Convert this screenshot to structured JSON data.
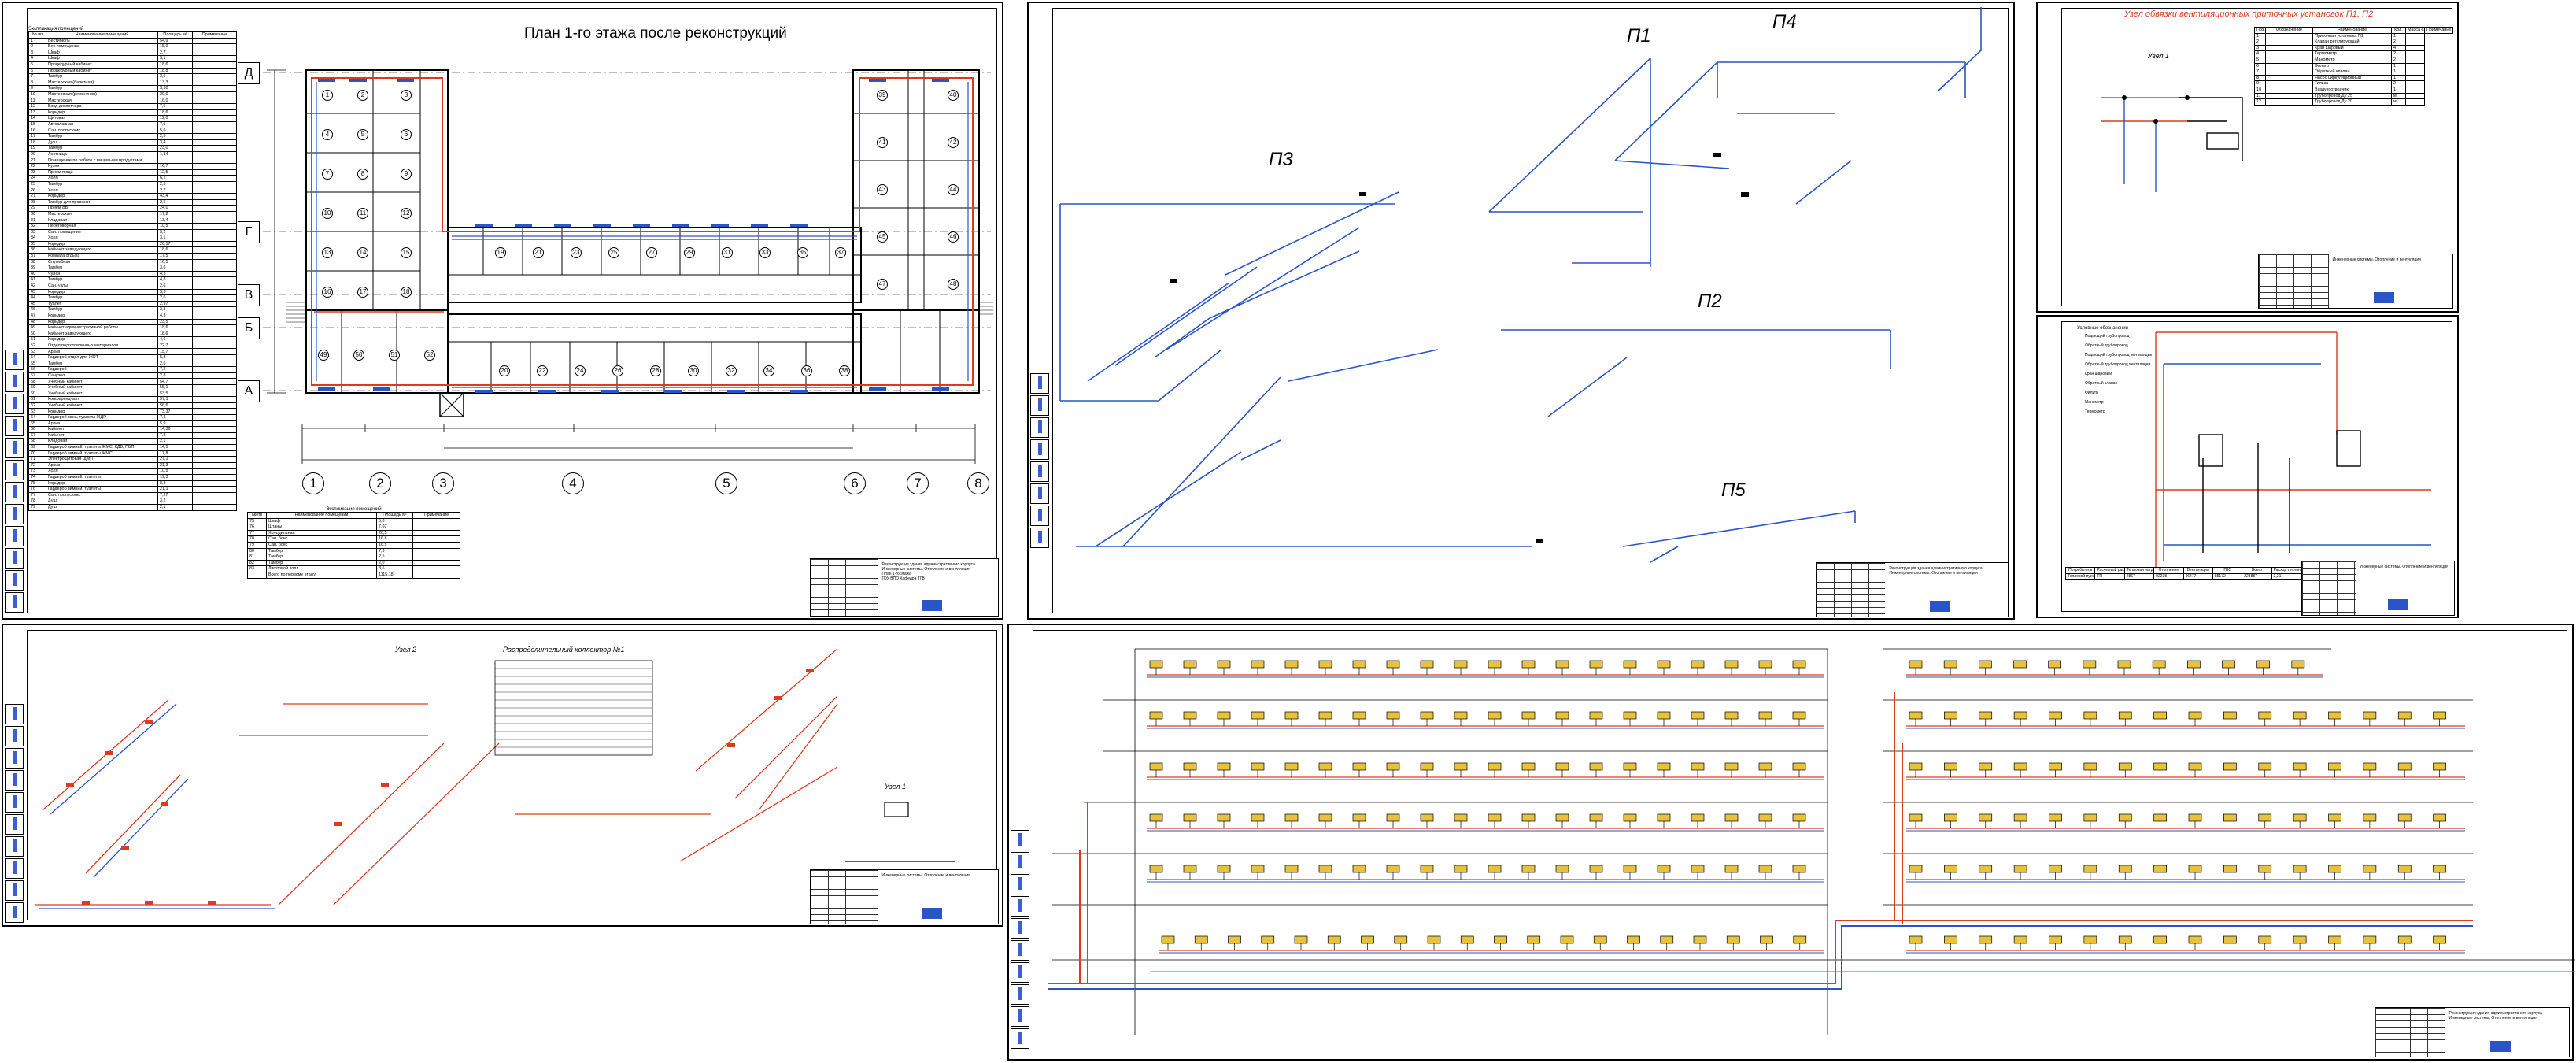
{
  "colors": {
    "supply_red": "#e03a1e",
    "return_blue": "#2a55c8",
    "line_black": "#000000",
    "stamp_blue": "#2a55c8"
  },
  "plan": {
    "title": "План 1-го этажа после реконструкций",
    "row_axes": [
      "Д",
      "Г",
      "В",
      "Б",
      "А"
    ],
    "col_axes": [
      "1",
      "2",
      "3",
      "4",
      "5",
      "6",
      "7",
      "8"
    ],
    "room_numbers": [
      "1",
      "2",
      "3",
      "4",
      "5",
      "6",
      "7",
      "8",
      "9",
      "10",
      "11",
      "12",
      "13",
      "14",
      "15",
      "16",
      "17",
      "18",
      "19",
      "20",
      "21",
      "22",
      "23",
      "24",
      "25",
      "26",
      "27",
      "28",
      "29",
      "30",
      "31",
      "32",
      "33",
      "34",
      "35",
      "36",
      "37",
      "38",
      "39",
      "40",
      "41",
      "42",
      "43",
      "44",
      "45",
      "46",
      "47",
      "48",
      "49",
      "50",
      "51",
      "52",
      "53",
      "54",
      "55",
      "56",
      "57",
      "58"
    ],
    "table_main": {
      "caption": "Экспликация помещений",
      "headers": [
        "№ пп",
        "Наименование помещений",
        "Площадь м²",
        "Примечание"
      ],
      "rows": [
        [
          "1",
          "Вестибюль",
          "54,9",
          ""
        ],
        [
          "2",
          "Вес помещение",
          "15,0",
          ""
        ],
        [
          "3",
          "Шкаф",
          "2,7",
          ""
        ],
        [
          "4",
          "Шкаф",
          "3,1",
          ""
        ],
        [
          "5",
          "Процедурный кабинет",
          "18,6",
          ""
        ],
        [
          "6",
          "Процедурный кабинет",
          "18,8",
          ""
        ],
        [
          "7",
          "Тамбур",
          "3,5",
          ""
        ],
        [
          "8",
          "Мастерская (балетная)",
          "13,3",
          ""
        ],
        [
          "9",
          "Тамбур",
          "3,50",
          ""
        ],
        [
          "10",
          "Мастерская (ремонтная)",
          "20,0",
          ""
        ],
        [
          "11",
          "Мастерская",
          "16,0",
          ""
        ],
        [
          "12",
          "Вход диспетчера",
          "7,5",
          ""
        ],
        [
          "13",
          "Коридор",
          "18,6",
          ""
        ],
        [
          "14",
          "Щитовая",
          "12,0",
          ""
        ],
        [
          "15",
          "Автоклавная",
          "7,5",
          ""
        ],
        [
          "16",
          "Сан. пропускник",
          "5,6",
          ""
        ],
        [
          "17",
          "Тамбур",
          "2,5",
          ""
        ],
        [
          "18",
          "Душ",
          "3,4",
          ""
        ],
        [
          "19",
          "Тамбур",
          "23,0",
          ""
        ],
        [
          "20",
          "Лестница",
          "1,84",
          ""
        ],
        [
          "21",
          "Помещение по работе с пищевыми продуктами",
          "",
          ""
        ],
        [
          "22",
          "Кухня",
          "16,7",
          ""
        ],
        [
          "23",
          "Прием пищи",
          "12,5",
          ""
        ],
        [
          "24",
          "Холл",
          "6,2",
          ""
        ],
        [
          "25",
          "Тамбур",
          "2,5",
          ""
        ],
        [
          "26",
          "Холл",
          "2,7",
          ""
        ],
        [
          "27",
          "Коридор",
          "43,4",
          ""
        ],
        [
          "28",
          "Тамбур для провозки",
          "2,5",
          ""
        ],
        [
          "29",
          "Прием ВВ",
          "24,0",
          ""
        ],
        [
          "30",
          "Мастерская",
          "17,2",
          ""
        ],
        [
          "31",
          "Кладовая",
          "13,4",
          ""
        ],
        [
          "32",
          "Переговорная",
          "10,5",
          ""
        ],
        [
          "33",
          "Сан. помещение",
          "5,2",
          ""
        ],
        [
          "34",
          "Холл",
          "3,1",
          ""
        ],
        [
          "35",
          "Коридор",
          "26,17",
          ""
        ],
        [
          "36",
          "Кабинет заведующего",
          "18,6",
          ""
        ],
        [
          "37",
          "Комната отдыха",
          "17,5",
          ""
        ],
        [
          "38",
          "Служебная",
          "16,5",
          ""
        ],
        [
          "39",
          "Тамбур",
          "3,6",
          ""
        ],
        [
          "40",
          "Чулан",
          "4,3",
          ""
        ],
        [
          "41",
          "Тамбур",
          "4,3",
          ""
        ],
        [
          "42",
          "Сан. узлы",
          "2,6",
          ""
        ],
        [
          "43",
          "Коридор",
          "3,3",
          ""
        ],
        [
          "44",
          "Тамбур",
          "2,6",
          ""
        ],
        [
          "45",
          "Туалет",
          "2,97",
          ""
        ],
        [
          "46",
          "Тамбур",
          "3,3",
          ""
        ],
        [
          "47",
          "Коридор",
          "4,3",
          ""
        ],
        [
          "48",
          "Коридор",
          "23,5",
          ""
        ],
        [
          "49",
          "Кабинет административной работы",
          "18,6",
          ""
        ],
        [
          "50",
          "Кабинет заведующего",
          "18,6",
          ""
        ],
        [
          "51",
          "Коридор",
          "4,6",
          ""
        ],
        [
          "52",
          "Отдел подготовленных материалов",
          "22,7",
          ""
        ],
        [
          "53",
          "Архив",
          "15,7",
          ""
        ],
        [
          "54",
          "Гардероб отдел для ЖОТ",
          "5,3",
          ""
        ],
        [
          "55",
          "Тамбур",
          "2,6",
          ""
        ],
        [
          "56",
          "Гардероб",
          "7,2",
          ""
        ],
        [
          "57",
          "Санузел",
          "2,8",
          ""
        ],
        [
          "58",
          "Учебный кабинет",
          "54,7",
          ""
        ],
        [
          "59",
          "Учебный кабинет",
          "55,1",
          ""
        ],
        [
          "60",
          "Учебный кабинет",
          "53,5",
          ""
        ],
        [
          "61",
          "Конференц-зал",
          "57,1",
          ""
        ],
        [
          "62",
          "Учебный кабинет",
          "56,6",
          ""
        ],
        [
          "63",
          "Коридор",
          "73,37",
          ""
        ],
        [
          "64",
          "Гардероб зона, туалеты ЖДР",
          "7,2",
          ""
        ],
        [
          "65",
          "Архив",
          "5,9",
          ""
        ],
        [
          "66",
          "Кабинет",
          "14,36",
          ""
        ],
        [
          "67",
          "Кабинет",
          "7,8",
          ""
        ],
        [
          "68",
          "Кладовая",
          "2,1",
          ""
        ],
        [
          "69",
          "Гардероб зимний, туалеты ЖМС, КДВ, ПБП",
          "14,5",
          ""
        ],
        [
          "70",
          "Гардероб зимний, туалеты ЖМС",
          "17,8",
          ""
        ],
        [
          "71",
          "Электрощитовая ЩМП",
          "27,1",
          ""
        ],
        [
          "72",
          "Архив",
          "21,3",
          ""
        ],
        [
          "73",
          "Холл",
          "10,5",
          ""
        ],
        [
          "74",
          "Гардероб зимний, туалеты",
          "19,3",
          ""
        ],
        [
          "75",
          "Коридор",
          "8,8",
          ""
        ],
        [
          "76",
          "Гардероб зимний, туалеты",
          "21,1",
          ""
        ],
        [
          "77",
          "Сан. пропускник",
          "7,27",
          ""
        ],
        [
          "78",
          "Душ",
          "3,2",
          ""
        ],
        [
          "79",
          "Душ",
          "2,1",
          ""
        ]
      ]
    },
    "table_small": {
      "caption": "Экспликация помещений",
      "headers": [
        "№ пп",
        "Наименование помещений",
        "Площадь м²",
        "Примечание"
      ],
      "rows": [
        [
          "75",
          "Шкаф",
          "5,8",
          ""
        ],
        [
          "76",
          "Штаны",
          "7,07",
          ""
        ],
        [
          "77",
          "Холодильная",
          "20,5",
          ""
        ],
        [
          "78",
          "Сан. бокс",
          "16,8",
          ""
        ],
        [
          "79",
          "Сан. бокс",
          "16,5",
          ""
        ],
        [
          "80",
          "Тамбур",
          "7,9",
          ""
        ],
        [
          "81",
          "Тамбур",
          "2,5",
          ""
        ],
        [
          "82",
          "Тамбур",
          "2,0",
          ""
        ],
        [
          "83",
          "Лифтовой холл",
          "8,6",
          ""
        ]
      ],
      "total": [
        "Всего по первому этажу",
        "1115,18"
      ]
    }
  },
  "axon": {
    "systems": [
      "П1",
      "П2",
      "П3",
      "П4",
      "П5"
    ]
  },
  "unit": {
    "title": "Узел обвязки вентиляционных приточных установок П1, П2",
    "node_title": "Узел 1",
    "table_headers": [
      "Поз.",
      "Обозначение",
      "Наименование",
      "Кол.",
      "Масса ед. кг",
      "Примечание"
    ],
    "table_rows": [
      [
        "1",
        "",
        "Приточная установка П1",
        "1",
        ""
      ],
      [
        "2",
        "",
        "Клапан регулирующий",
        "2",
        ""
      ],
      [
        "3",
        "",
        "Кран шаровый",
        "4",
        ""
      ],
      [
        "4",
        "",
        "Термометр",
        "2",
        ""
      ],
      [
        "5",
        "",
        "Манометр",
        "2",
        ""
      ],
      [
        "6",
        "",
        "Фильтр",
        "1",
        ""
      ],
      [
        "7",
        "",
        "Обратный клапан",
        "1",
        ""
      ],
      [
        "8",
        "",
        "Насос циркуляционный",
        "1",
        ""
      ],
      [
        "9",
        "",
        "Гильза",
        "2",
        ""
      ],
      [
        "10",
        "",
        "Воздухоотводчик",
        "1",
        ""
      ],
      [
        "11",
        "",
        "Трубопровод Ду 25",
        "м",
        ""
      ],
      [
        "12",
        "",
        "Трубопровод Ду 20",
        "м",
        ""
      ]
    ]
  },
  "heating_node": {
    "legend_title": "Условные обозначения",
    "legend": [
      "Подающий трубопровод",
      "Обратный трубопровод",
      "Подающий трубопровод вентиляции",
      "Обратный трубопровод вентиляции",
      "Кран шаровый",
      "Обратный клапан",
      "Фильтр",
      "Манометр",
      "Термометр"
    ],
    "calc_headers": [
      "Потребитель",
      "Расчетный расход тепла",
      "Тепловая нагрузка",
      "Отопление",
      "Вентиляция",
      "ГВС",
      "Всего",
      "Расход теплоносителя"
    ],
    "calc_row": [
      "Тепловой пункт",
      "ТП",
      "2867",
      "92238",
      "46477",
      "85172",
      "223887",
      "3,21"
    ]
  },
  "ventilation": {
    "table_title": "Распределительный коллектор №1",
    "node_title": "Узел 2",
    "node_title_2": "Узел 1"
  },
  "stamp": {
    "line1": "Реконструкция здания административного корпуса",
    "line2": "Инженерные системы. Отопление и вентиляция",
    "line3": "План 1-го этажа",
    "org": "ГОУ ВПО Кафедра ТГВ"
  }
}
